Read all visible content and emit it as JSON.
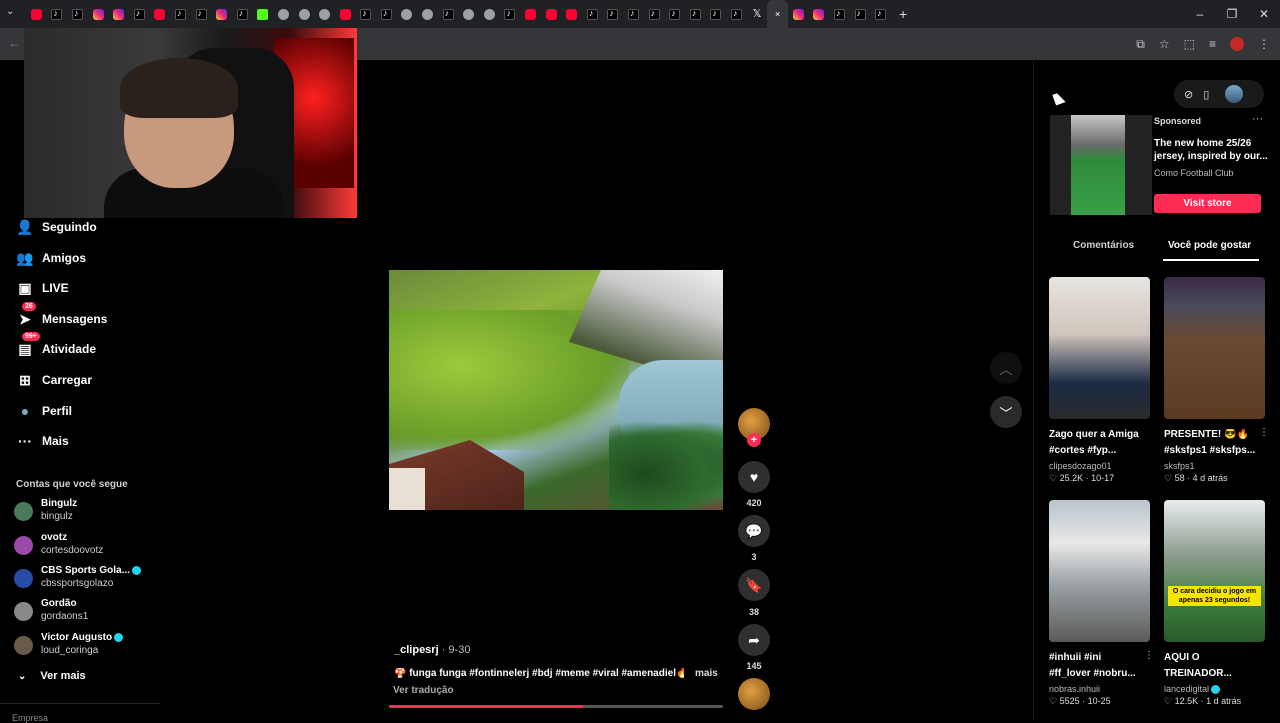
{
  "browser": {
    "tabs": [
      "yt",
      "tt",
      "tt",
      "ig",
      "ig",
      "tt",
      "yt",
      "tt",
      "tt",
      "ig",
      "tt",
      "kk",
      "gl",
      "gl",
      "gl",
      "yt",
      "tt",
      "tt",
      "gl",
      "gl",
      "tt",
      "gl",
      "gl",
      "tt",
      "yt",
      "yt",
      "yt",
      "tt",
      "tt",
      "tt",
      "tt",
      "tt",
      "tt",
      "tt",
      "tt",
      "x",
      "active",
      "ig",
      "ig",
      "tt",
      "tt",
      "tt"
    ],
    "active_tab_close": "×",
    "new_tab": "+",
    "window_controls": [
      "–",
      "❐",
      "✕"
    ]
  },
  "sidebar": {
    "nav": [
      {
        "label": "Seguindo",
        "icon": "person-add-icon",
        "glyph": "👤"
      },
      {
        "label": "Amigos",
        "icon": "people-icon",
        "glyph": "👥"
      },
      {
        "label": "LIVE",
        "icon": "live-icon",
        "glyph": "▣"
      },
      {
        "label": "Mensagens",
        "icon": "paper-plane-icon",
        "glyph": "➤",
        "badge": "26"
      },
      {
        "label": "Atividade",
        "icon": "inbox-icon",
        "glyph": "▤",
        "badge": "99+"
      },
      {
        "label": "Carregar",
        "icon": "upload-plus-icon",
        "glyph": "⊞"
      },
      {
        "label": "Perfil",
        "icon": "avatar-icon",
        "glyph": "●"
      },
      {
        "label": "Mais",
        "icon": "more-dots-icon",
        "glyph": "···"
      }
    ],
    "follow_title": "Contas que você segue",
    "following": [
      {
        "name": "Bingulz",
        "handle": "bingulz",
        "verified": false,
        "color": "#4a7a5a"
      },
      {
        "name": "ovotz",
        "handle": "cortesdoovotz",
        "verified": false,
        "color": "#9a4aa8"
      },
      {
        "name": "CBS Sports Gola...",
        "handle": "cbssportsgolazo",
        "verified": true,
        "color": "#2a4aa8"
      },
      {
        "name": "Gordão",
        "handle": "gordaons1",
        "verified": false,
        "color": "#888888"
      },
      {
        "name": "Victor Augusto",
        "handle": "loud_coringa",
        "verified": true,
        "color": "#6a5a4a"
      }
    ],
    "see_more": "Ver mais",
    "cut_label": "Empresa"
  },
  "video": {
    "author": "_clipesrj",
    "date": " · 9-30",
    "caption": "🍄 funga funga #fontinnelerj #bdj #meme #viral #amenadiel🔥",
    "more": "mais",
    "translate": "Ver tradução",
    "progress_fraction": 0.58
  },
  "actions": {
    "likes": "420",
    "comments": "3",
    "saves": "38",
    "shares": "145"
  },
  "ad": {
    "sponsored": "Sponsored",
    "title": "The new home 25/26 jersey, inspired by our...",
    "brand": "Como Football Club",
    "cta": "Visit store"
  },
  "right_tabs": {
    "comments": "Comentários",
    "you_may_like": "Você pode gostar"
  },
  "recommendations": [
    {
      "t1": "Zago quer a Amiga",
      "t2": "#cortes #fyp...",
      "author": "clipesdozago01",
      "stats": "♡ 25.2K · 10-17",
      "verified": false
    },
    {
      "t1": "PRESENTE! 😎🔥",
      "t2": "#sksfps1 #sksfps...",
      "author": "sksfps1",
      "stats": "♡ 58 · 4 d atrás",
      "verified": false
    },
    {
      "t1": "#inhuii #ini",
      "t2": "#ff_lover #nobru...",
      "author": "nobras.inhuii",
      "stats": "♡ 5525 · 10-25",
      "verified": false
    },
    {
      "t1": "AQUI O",
      "t2": "TREINADOR...",
      "author": "lancedigital",
      "stats": "♡ 12.5K · 1 d atrás",
      "verified": true,
      "overlay": "O cara decidiu o jogo em apenas 23 segundos!"
    }
  ]
}
